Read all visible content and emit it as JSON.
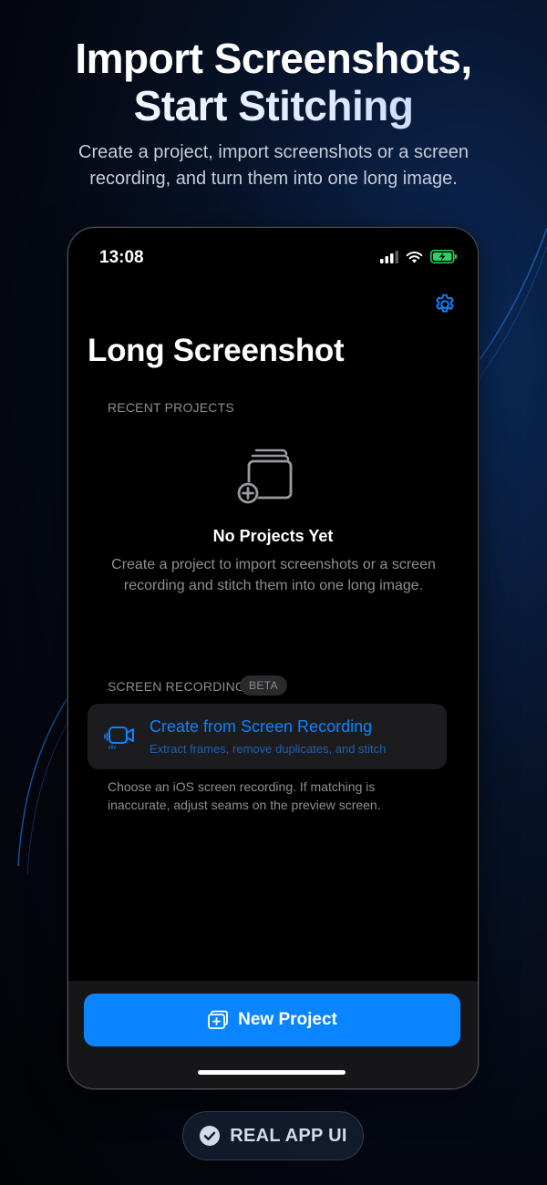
{
  "header": {
    "headline_line1": "Import Screenshots,",
    "headline_line2": "Start Stitching",
    "subtitle": "Create a project, import screenshots or a screen recording, and turn them into one long image."
  },
  "status_bar": {
    "time": "13:08",
    "icons": [
      "cellular-signal-icon",
      "wifi-icon",
      "battery-charging-icon"
    ]
  },
  "app": {
    "title": "Long Screenshot",
    "settings_icon": "gear-icon",
    "recent_projects_label": "RECENT PROJECTS",
    "empty_state": {
      "icon": "add-project-stack-icon",
      "title": "No Projects Yet",
      "description": "Create a project to import screenshots or a screen recording and stitch them into one long image."
    },
    "screen_recording": {
      "label": "SCREEN RECORDING",
      "badge": "BETA",
      "card_icon": "video-camera-icon",
      "card_title": "Create from Screen Recording",
      "card_subtitle": "Extract frames, remove duplicates, and stitch",
      "note": "Choose an iOS screen recording. If matching is inaccurate, adjust seams on the preview screen."
    },
    "new_project_button": {
      "icon": "new-project-icon",
      "label": "New Project"
    }
  },
  "footer_badge": {
    "icon": "checkmark-circle-icon",
    "label": "REAL APP UI"
  },
  "colors": {
    "accent": "#0a84ff",
    "background": "#000000",
    "card": "#1c1c1e",
    "secondary_text": "#8e8e93",
    "battery": "#30d158"
  }
}
